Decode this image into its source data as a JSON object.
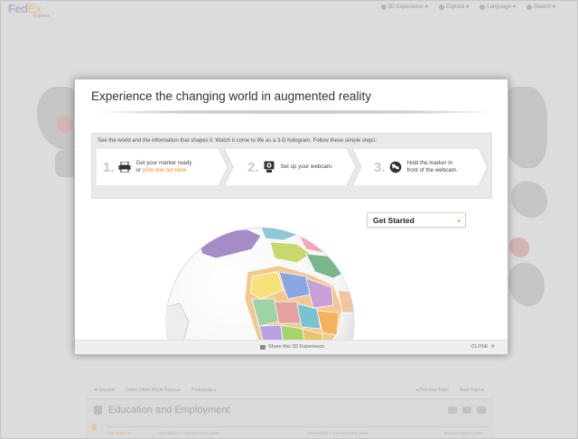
{
  "header": {
    "logo_fed": "Fed",
    "logo_ex": "Ex",
    "logo_sub": "Express",
    "nav": [
      {
        "label": "3D Experience",
        "icon": "cube-icon"
      },
      {
        "label": "Explore",
        "icon": "compass-icon"
      },
      {
        "label": "Language",
        "icon": "speech-icon"
      },
      {
        "label": "Search",
        "icon": "search-icon"
      }
    ]
  },
  "modal": {
    "title": "Experience the changing world in augmented reality",
    "intro": "See the world and the information that shapes it. Watch it come to life as a 3-D hologram. Follow these simple steps:",
    "steps": [
      {
        "number": "1.",
        "line1": "Get your marker ready",
        "line2_prefix": "or ",
        "link": "print one out here.",
        "icon": "printer-icon"
      },
      {
        "number": "2.",
        "line1": "Set up your webcam.",
        "icon": "webcam-icon"
      },
      {
        "number": "3.",
        "line1": "Hold the marker in",
        "line2": "front of the webcam.",
        "icon": "globe-icon"
      }
    ],
    "get_started": "Get Started",
    "share": "Share this 3D Experience",
    "close": "CLOSE"
  },
  "background": {
    "actions_left": [
      "Expand",
      "Select Other World Topics",
      "Participate"
    ],
    "actions_right": [
      "Previous Topic",
      "Next Topic"
    ],
    "section_title": "Education and Employment",
    "timeline": [
      "THE WORLD",
      "UNIVERSITY GRADUATES 1995",
      "UNIVERSITY GRADUATES 2005",
      "EMPLOYMENT AND"
    ]
  },
  "colors": {
    "accent": "#f08a1a",
    "overlay": "#dcdcdc"
  }
}
